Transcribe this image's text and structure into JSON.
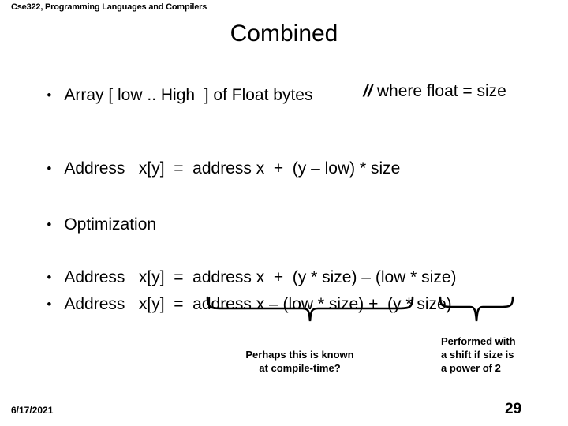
{
  "slide": {
    "header": "Cse322, Programming Languages and Compilers",
    "title": "Combined",
    "background_color": "#ffffff",
    "text_color": "#000000"
  },
  "bullets": [
    {
      "name": "array-declaration",
      "marker": "•",
      "text": "Array [ low .. High  ] of Float bytes",
      "comment": "where float = size",
      "comment_prefix": "//"
    },
    {
      "name": "address-formula-basic",
      "marker": "•",
      "text": "Address   x[y]  =  address x  +  (y – low) * size"
    },
    {
      "name": "optimization",
      "marker": "•",
      "text": "Optimization"
    },
    {
      "name": "address-formula-expanded",
      "marker": "•",
      "text": "Address   x[y]  =  address x  +  (y * size) – (low * size)"
    },
    {
      "name": "address-formula-reordered",
      "marker": "•",
      "text": "Address   x[y]  =  address x – (low * size) +  (y * size)"
    }
  ],
  "annotations": [
    {
      "name": "compile-time-note",
      "text": "Perhaps this is known\nat compile-time?"
    },
    {
      "name": "shift-note",
      "text": "Performed with\na shift if size is\na power of 2"
    }
  ],
  "footer": {
    "date": "6/17/2021",
    "page_number": "29"
  }
}
